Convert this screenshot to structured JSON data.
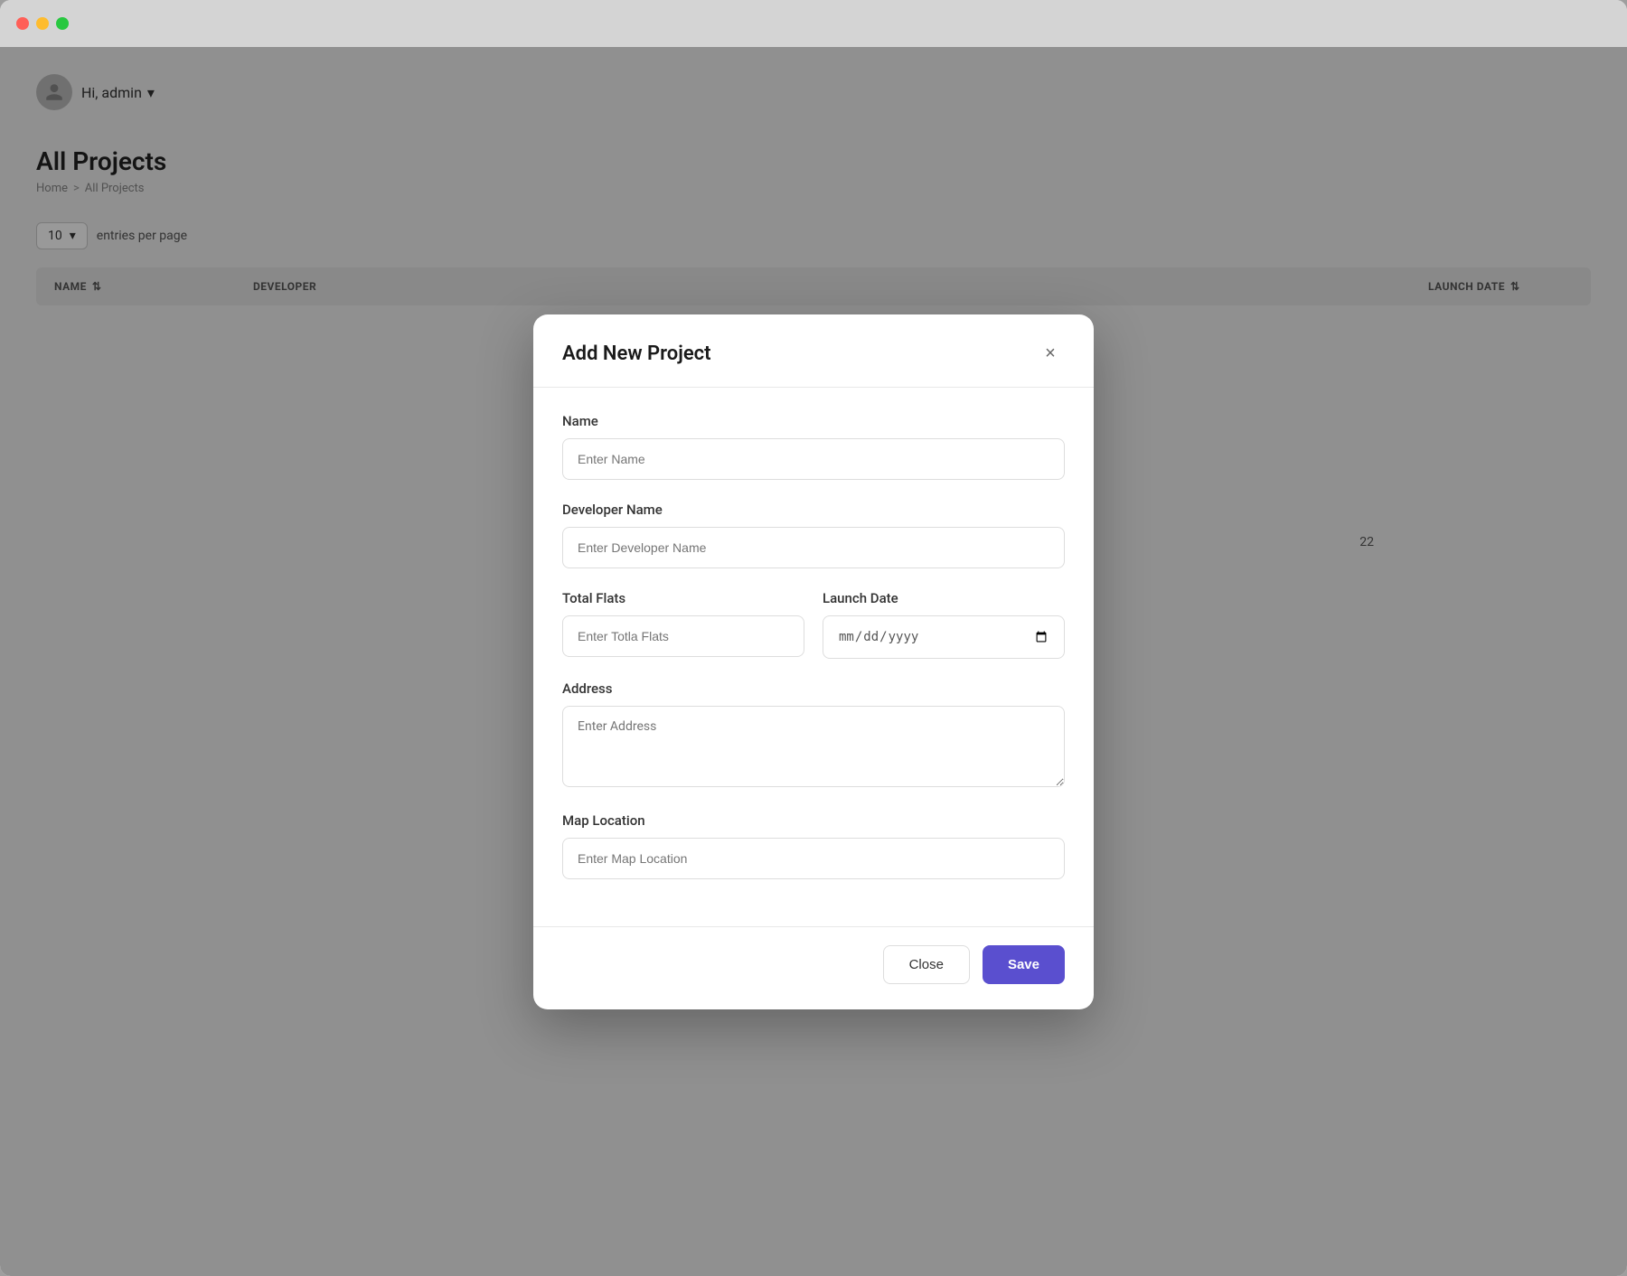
{
  "window": {
    "traffic_lights": [
      "red",
      "yellow",
      "green"
    ]
  },
  "app": {
    "admin_greeting": "Hi, admin",
    "admin_dropdown_icon": "▾",
    "page_title": "All Projects",
    "breadcrumb": {
      "home": "Home",
      "separator": ">",
      "current": "All Projects"
    },
    "table_controls": {
      "entries_value": "10",
      "entries_label": "entries per page"
    },
    "table_headers": [
      "NAME",
      "DEVELOPER",
      "",
      "LAUNCH DATE"
    ],
    "number_display": "22"
  },
  "modal": {
    "title": "Add New Project",
    "close_button_label": "×",
    "fields": {
      "name": {
        "label": "Name",
        "placeholder": "Enter Name"
      },
      "developer_name": {
        "label": "Developer Name",
        "placeholder": "Enter Developer Name"
      },
      "total_flats": {
        "label": "Total Flats",
        "placeholder": "Enter Totla Flats"
      },
      "launch_date": {
        "label": "Launch Date",
        "placeholder": "mm/dd/yyyy"
      },
      "address": {
        "label": "Address",
        "placeholder": "Enter Address"
      },
      "map_location": {
        "label": "Map Location",
        "placeholder": "Enter Map Location"
      }
    },
    "footer": {
      "close_label": "Close",
      "save_label": "Save"
    }
  }
}
